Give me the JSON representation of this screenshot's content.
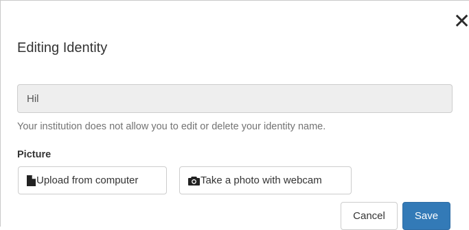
{
  "dialog": {
    "title": "Editing Identity",
    "close_icon": "close-icon"
  },
  "identity": {
    "name_value": "Hil",
    "help_text": "Your institution does not allow you to edit or delete your identity name."
  },
  "picture": {
    "label": "Picture",
    "upload_label": "Upload from computer",
    "upload_icon": "file-icon",
    "webcam_label": "Take a photo with webcam",
    "webcam_icon": "camera-icon"
  },
  "footer": {
    "cancel_label": "Cancel",
    "save_label": "Save"
  },
  "colors": {
    "primary": "#337ab7",
    "input_background": "#eeeeee",
    "help_text": "#737373"
  }
}
